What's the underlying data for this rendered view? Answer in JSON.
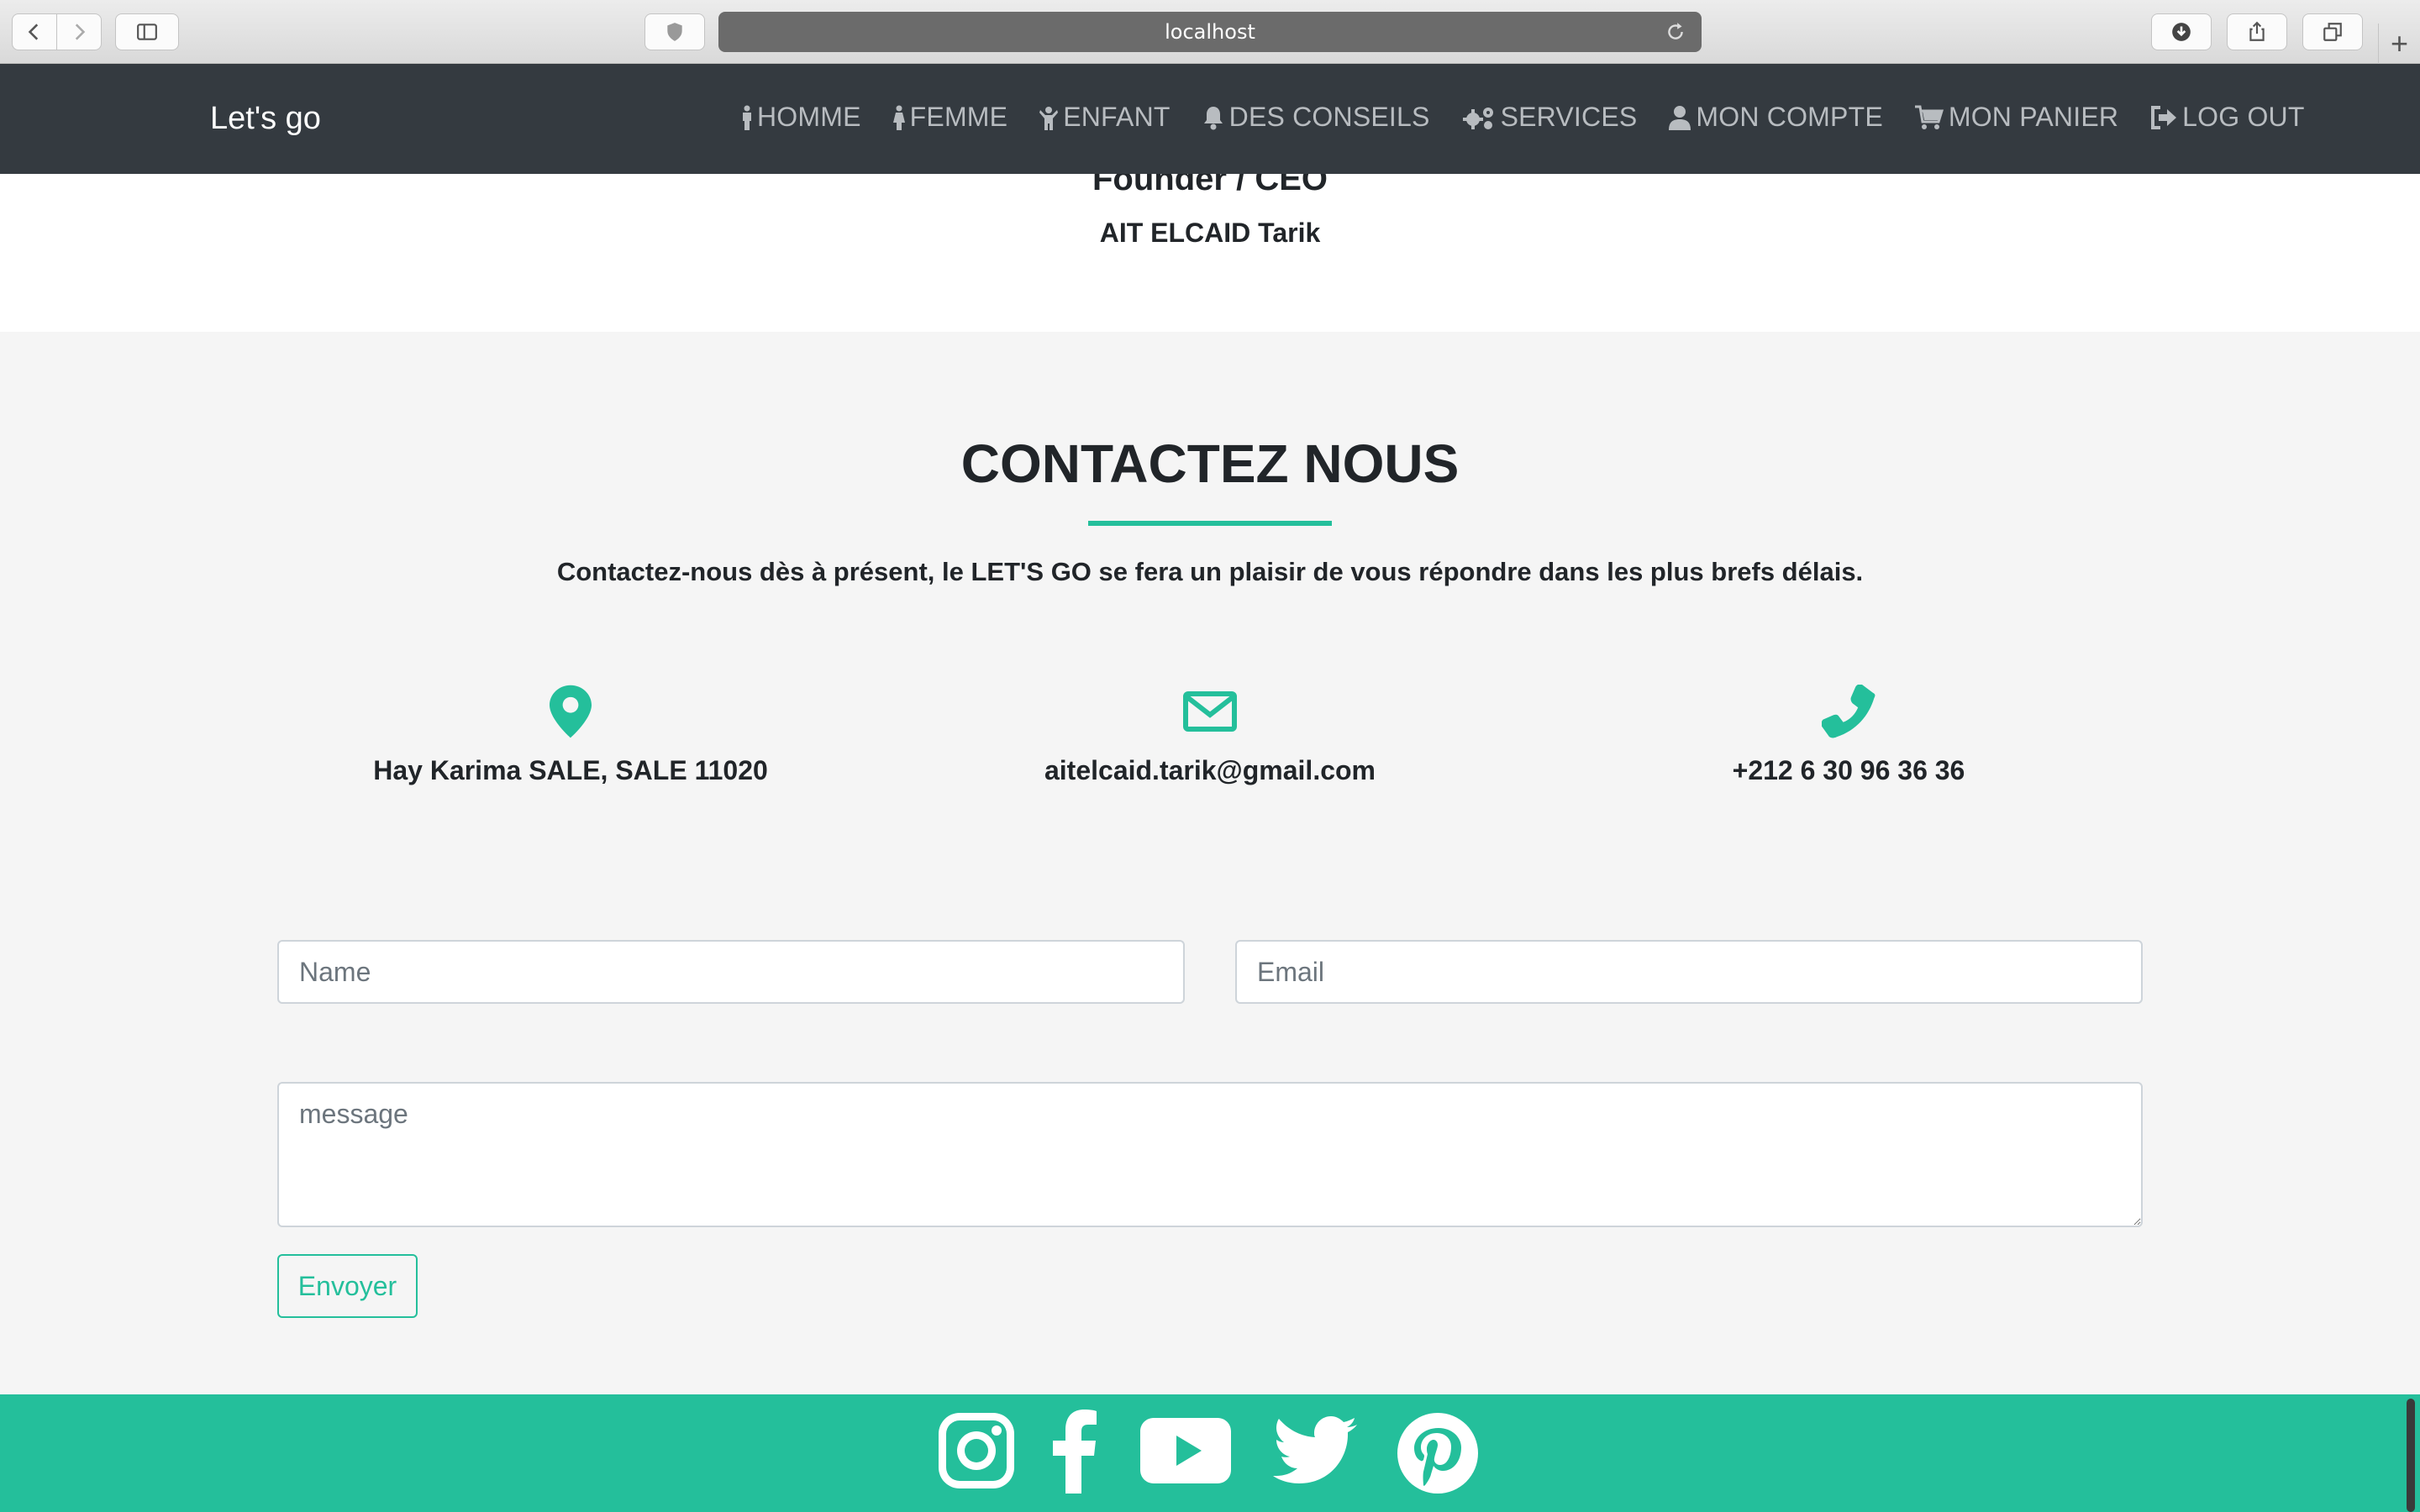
{
  "browser": {
    "url": "localhost",
    "icons": [
      "back-icon",
      "forward-icon",
      "sidebar-icon",
      "shield-icon",
      "reload-icon",
      "download-icon",
      "share-icon",
      "tabs-icon",
      "plus-icon"
    ]
  },
  "navbar": {
    "brand": "Let's go",
    "items": [
      {
        "label": "HOMME",
        "icon": "man-icon"
      },
      {
        "label": "FEMME",
        "icon": "woman-icon"
      },
      {
        "label": "ENFANT",
        "icon": "child-icon"
      },
      {
        "label": "DES CONSEILS",
        "icon": "bell-icon"
      },
      {
        "label": "SERVICES",
        "icon": "gears-icon"
      },
      {
        "label": "MON COMPTE",
        "icon": "user-icon"
      },
      {
        "label": "MON PANIER",
        "icon": "cart-icon"
      },
      {
        "label": "LOG OUT",
        "icon": "logout-icon"
      }
    ]
  },
  "about": {
    "role": "Founder / CEO",
    "person": "AIT ELCAID Tarik"
  },
  "contact": {
    "title": "CONTACTEZ NOUS",
    "subtitle": "Contactez-nous dès à présent, le LET'S GO se fera un plaisir de vous répondre dans les plus brefs délais.",
    "address": "Hay Karima SALE, SALE 11020",
    "email": "aitelcaid.tarik@gmail.com",
    "phone": "+212 6 30 96 36 36",
    "form": {
      "name_placeholder": "Name",
      "email_placeholder": "Email",
      "message_placeholder": "message",
      "submit_label": "Envoyer"
    }
  },
  "footer": {
    "social": [
      "instagram-icon",
      "facebook-icon",
      "youtube-icon",
      "twitter-icon",
      "pinterest-icon"
    ]
  },
  "colors": {
    "accent": "#24bf9b",
    "navbar": "#343a40",
    "section_bg": "#f5f5f5"
  }
}
